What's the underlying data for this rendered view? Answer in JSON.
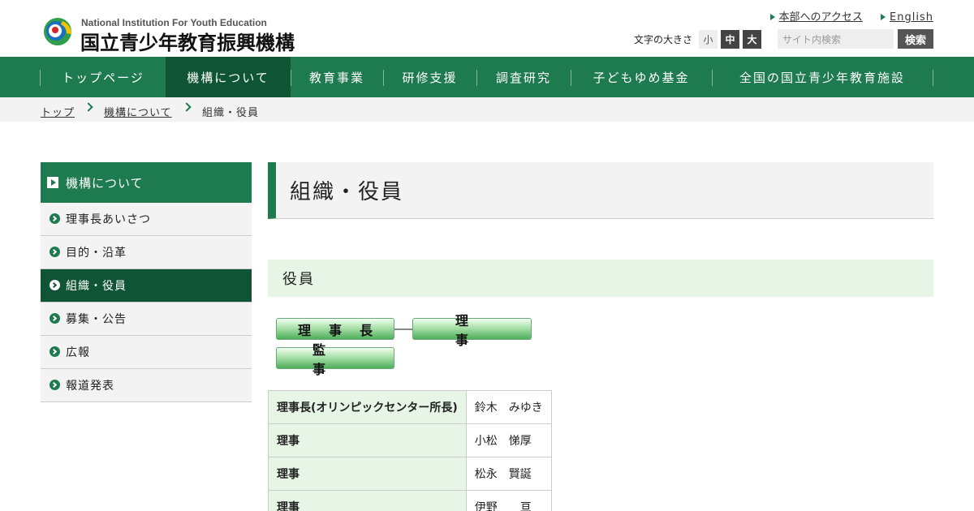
{
  "header": {
    "logo_en": "National Institution For Youth Education",
    "logo_ja": "国立青少年教育振興機構",
    "links": [
      "本部へのアクセス",
      "English"
    ],
    "font_size_label": "文字の大きさ",
    "font_size_options": [
      "小",
      "中",
      "大"
    ],
    "search_placeholder": "サイト内検索",
    "search_button": "検索",
    "colors": {
      "brand_green": "#1e7a4f",
      "dark_green": "#0f5435",
      "light_green": "#e6f5e6"
    }
  },
  "nav": {
    "items": [
      "トップページ",
      "機構について",
      "教育事業",
      "研修支援",
      "調査研究",
      "子どもゆめ基金",
      "全国の国立青少年教育施設"
    ],
    "active": "機構について"
  },
  "breadcrumb": [
    "トップ",
    "機構について",
    "組織・役員"
  ],
  "sidebar": {
    "heading": "機構について",
    "items": [
      "理事長あいさつ",
      "目的・沿革",
      "組織・役員",
      "募集・公告",
      "広報",
      "報道発表"
    ],
    "active": "組織・役員"
  },
  "main": {
    "title": "組織・役員",
    "section": "役員",
    "org_chart": [
      "理事長",
      "理事",
      "監事"
    ],
    "officers": [
      {
        "role": "理事長(オリンピックセンター所長)",
        "name": "鈴木　みゆき"
      },
      {
        "role": "理事",
        "name": "小松　悌厚"
      },
      {
        "role": "理事",
        "name": "松永　賢誕"
      },
      {
        "role": "理事",
        "name": "伊野　　亘"
      }
    ]
  }
}
